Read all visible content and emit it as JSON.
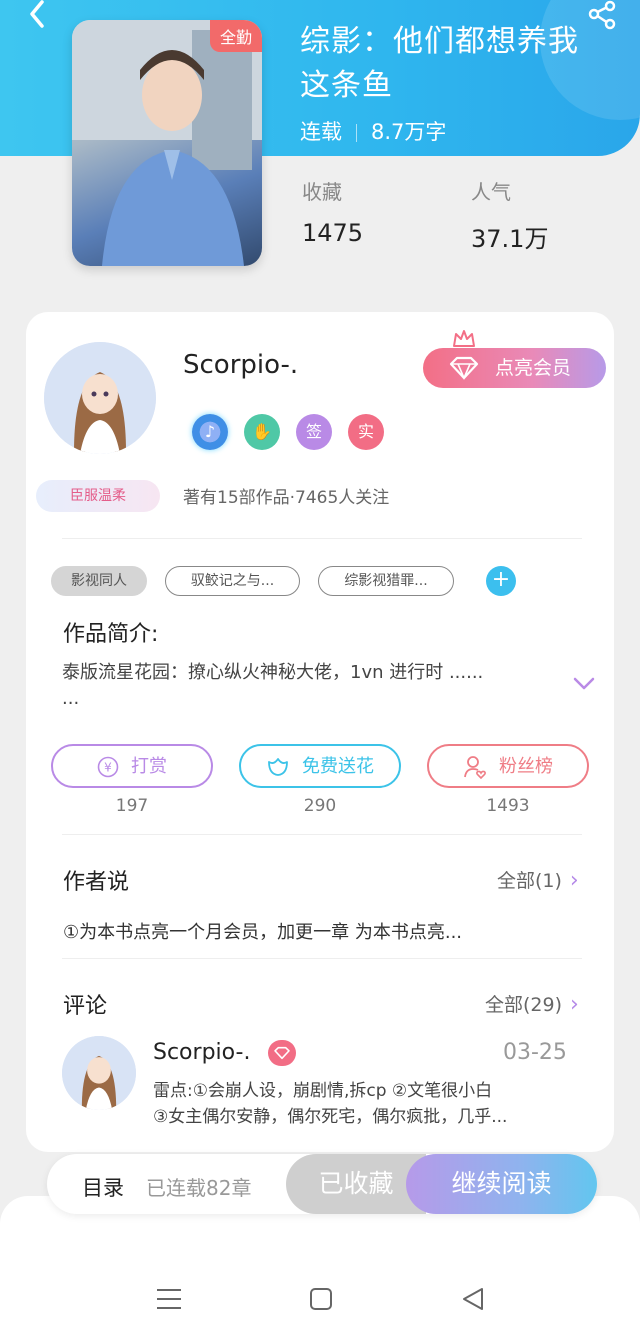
{
  "book": {
    "title": "综影：他们都想养我这条鱼",
    "status": "连载",
    "word_count": "8.7万字",
    "cover_badge": "全勤",
    "stats": [
      {
        "label": "收藏",
        "value": "1475"
      },
      {
        "label": "人气",
        "value": "37.1万"
      }
    ]
  },
  "author": {
    "name": "Scorpio-.",
    "avatar_tag": "臣服温柔",
    "vip_button": "点亮会员",
    "badges": [
      {
        "icon": "music-note-icon",
        "text": ""
      },
      {
        "icon": "handshake-icon",
        "text": ""
      },
      {
        "icon": "sign-badge",
        "text": "签"
      },
      {
        "icon": "verified-badge",
        "text": "实"
      }
    ],
    "works_line": "著有15部作品·7465人关注"
  },
  "tags": [
    "影视同人",
    "驭鲛记之与...",
    "综影视猎罪..."
  ],
  "intro": {
    "title": "作品简介:",
    "text": "泰版流星花园：撩心纵火神秘大佬，1vn 进行时 ......",
    "more": "..."
  },
  "actions": [
    {
      "label": "打赏",
      "icon": "yen-icon",
      "count": "197",
      "color": "#b98ae6"
    },
    {
      "label": "免费送花",
      "icon": "flower-icon",
      "count": "290",
      "color": "#3cc3e8"
    },
    {
      "label": "粉丝榜",
      "icon": "fan-rank-icon",
      "count": "1493",
      "color": "#ef7d86"
    }
  ],
  "author_say": {
    "title": "作者说",
    "more": "全部(1)",
    "text": "①为本书点亮一个月会员，加更一章 为本书点亮..."
  },
  "comments": {
    "title": "评论",
    "more": "全部(29)",
    "items": [
      {
        "name": "Scorpio-.",
        "date": "03-25",
        "line1": "雷点:①会崩人设，崩剧情,拆cp ②文笔很小白",
        "line2": "③女主偶尔安静，偶尔死宅，偶尔疯批，几乎..."
      }
    ]
  },
  "bottom": {
    "toc": "目录",
    "chapters": "已连载82章",
    "collected": "已收藏",
    "continue": "继续阅读"
  },
  "colors": {
    "header": "#2fb6ee",
    "accent_purple": "#b98ae6",
    "accent_pink": "#f36f86"
  }
}
